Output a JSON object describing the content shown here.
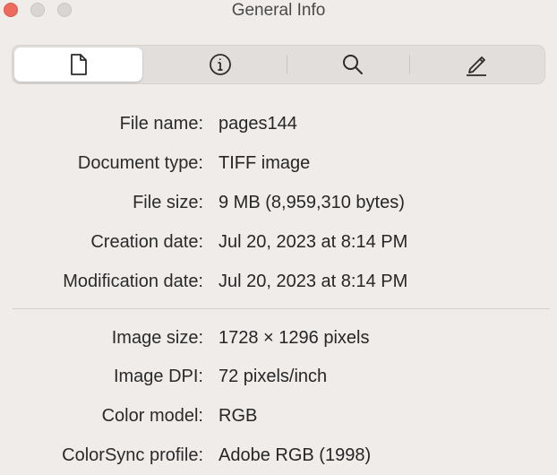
{
  "window": {
    "title": "General Info",
    "controls": [
      "close",
      "minimize",
      "zoom"
    ]
  },
  "toolbar": {
    "tabs": [
      {
        "icon": "document-icon",
        "selected": true
      },
      {
        "icon": "info-icon",
        "selected": false
      },
      {
        "icon": "magnifier-icon",
        "selected": false
      },
      {
        "icon": "pencil-icon",
        "selected": false
      }
    ]
  },
  "file_info": [
    {
      "label": "File name:",
      "value": "pages144"
    },
    {
      "label": "Document type:",
      "value": "TIFF image"
    },
    {
      "label": "File size:",
      "value": "9 MB (8,959,310 bytes)"
    },
    {
      "label": "Creation date:",
      "value": "Jul 20, 2023 at 8:14 PM"
    },
    {
      "label": "Modification date:",
      "value": "Jul 20, 2023 at 8:14 PM"
    }
  ],
  "image_info": [
    {
      "label": "Image size:",
      "value": "1728 × 1296 pixels"
    },
    {
      "label": "Image DPI:",
      "value": "72 pixels/inch"
    },
    {
      "label": "Color model:",
      "value": "RGB"
    },
    {
      "label": "ColorSync profile:",
      "value": "Adobe RGB (1998)"
    }
  ],
  "colors": {
    "background": "#f0ecea",
    "close": "#ee6a5f",
    "inactive_control": "#d9d5d3",
    "segment_selected": "#ffffff"
  }
}
